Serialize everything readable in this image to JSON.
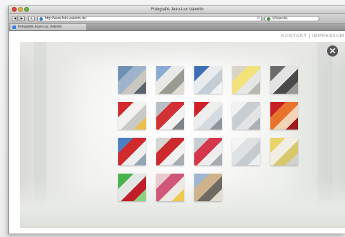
{
  "window": {
    "title": "Fotografie Jean-Luc Valentin"
  },
  "toolbar": {
    "back_label": "◀",
    "forward_label": "▶",
    "add_label": "+",
    "address": "http://www.foto-valentin.de/",
    "reload_label": "↻",
    "search_placeholder": "Wikipedia"
  },
  "tabs": [
    {
      "label": "Fotografie Jean-Luc Valentin"
    }
  ],
  "page": {
    "header_links": "KONTAKT | IMPRESSUM",
    "close_label": "✕"
  },
  "gallery": {
    "thumbnails": [
      {
        "name": "building-exterior-1",
        "colors": [
          "#6f8fb5",
          "#9fb4cc",
          "#c9c7bf",
          "#5a6470"
        ]
      },
      {
        "name": "building-exterior-2",
        "colors": [
          "#8aa9d3",
          "#e9e9e7",
          "#9b9b93",
          "#dedbd3"
        ]
      },
      {
        "name": "interior-blue",
        "colors": [
          "#3d6fb6",
          "#e8ecef",
          "#c4ccd4",
          "#f3f3f3"
        ]
      },
      {
        "name": "interior-lamps",
        "colors": [
          "#d9d5c8",
          "#f3e27a",
          "#e6e6e6",
          "#b9b7b0"
        ]
      },
      {
        "name": "entrance-dark",
        "colors": [
          "#6b6b6b",
          "#e3e3e3",
          "#4a4a4a",
          "#9a9a9a"
        ]
      },
      {
        "name": "hall-red-1",
        "colors": [
          "#d12a2e",
          "#f2f2f0",
          "#c9c9c5",
          "#e9c04a"
        ]
      },
      {
        "name": "corridor-red",
        "colors": [
          "#b8bfc6",
          "#d33234",
          "#f1f1f1",
          "#7c848c"
        ]
      },
      {
        "name": "room-red-2",
        "colors": [
          "#cf2228",
          "#eeeeec",
          "#d4dbe0",
          "#8e959c"
        ]
      },
      {
        "name": "hall-white",
        "colors": [
          "#f1f1f0",
          "#c8cdd2",
          "#e2e4e6",
          "#a9b0b7"
        ]
      },
      {
        "name": "red-orange-wall",
        "colors": [
          "#c61f24",
          "#e8732c",
          "#f2d3b5",
          "#9d1a1d"
        ]
      },
      {
        "name": "stair-blue-red",
        "colors": [
          "#4c7fc0",
          "#d02a2d",
          "#eeeeee",
          "#93a4b6"
        ]
      },
      {
        "name": "gym-red",
        "colors": [
          "#d6d6d4",
          "#cc2a2c",
          "#f0f0ee",
          "#a8adb2"
        ]
      },
      {
        "name": "corridor-pink",
        "colors": [
          "#c9cdd1",
          "#d6364a",
          "#eeeeee",
          "#a6abb0"
        ]
      },
      {
        "name": "white-room",
        "colors": [
          "#f4f4f3",
          "#dfe2e4",
          "#c6cbcf",
          "#eceeef"
        ]
      },
      {
        "name": "yellow-room",
        "colors": [
          "#e9d46a",
          "#f1efe4",
          "#d9c76b",
          "#cfd2d1"
        ]
      },
      {
        "name": "green-wall",
        "colors": [
          "#47b34a",
          "#e2e6e5",
          "#c21c2b",
          "#8fd17e"
        ]
      },
      {
        "name": "pink-lights",
        "colors": [
          "#e8c9cf",
          "#d0567a",
          "#efe9e6",
          "#f0c84e"
        ]
      },
      {
        "name": "building-facade",
        "colors": [
          "#9fb5cf",
          "#cdb28c",
          "#6e6a61",
          "#e4ddd0"
        ]
      }
    ]
  }
}
